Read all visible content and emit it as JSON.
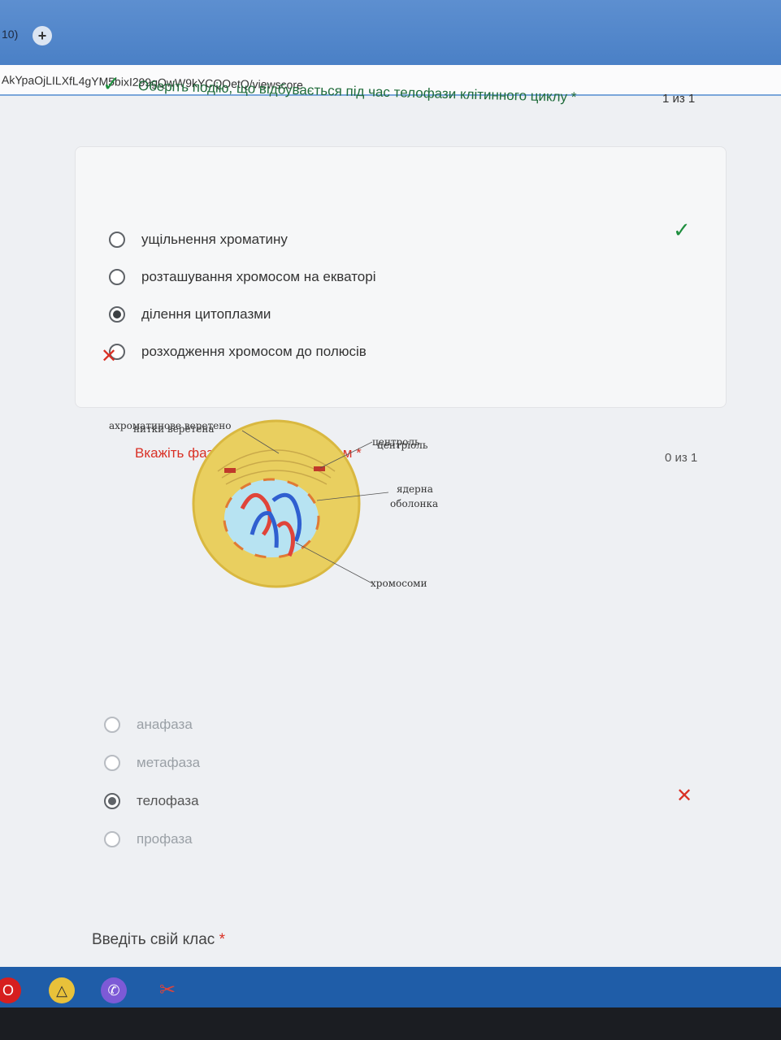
{
  "browser": {
    "tab_count": "10)",
    "new_tab_symbol": "+",
    "url": "AkYpaOjLILXfL4gYM5bixI299gQwW9kYCQOetQ/viewscore"
  },
  "question1": {
    "title": "Оберіть подію, що відбувається під час телофази клітинного циклу *",
    "score": "1 из 1",
    "status": "correct",
    "options": [
      {
        "label": "ущільнення хроматину",
        "selected": false
      },
      {
        "label": "розташування хромосом на екваторі",
        "selected": false
      },
      {
        "label": "ділення цитоплазми",
        "selected": true
      },
      {
        "label": "розходження хромосом до полюсів",
        "selected": false
      }
    ]
  },
  "question2": {
    "title": "Вкажіть фазу мітоза за малюнком *",
    "score": "0 из 1",
    "status": "incorrect",
    "diagram_labels": {
      "spindle": "ахроматинове веретено",
      "spindle_overlay": "нитки веретена",
      "centriole": "центроль",
      "centriole_overlay": "центріоль",
      "envelope_1": "ядерна",
      "envelope_2": "оболонка",
      "chromosomes": "хромосоми"
    },
    "options": [
      {
        "label": "анафаза",
        "selected": false
      },
      {
        "label": "метафаза",
        "selected": false
      },
      {
        "label": "телофаза",
        "selected": true
      },
      {
        "label": "профаза",
        "selected": false
      }
    ]
  },
  "question3": {
    "label": "Введіть свій клас",
    "required_mark": "*"
  },
  "colors": {
    "correct": "#1e8e3e",
    "incorrect": "#d93025",
    "taskbar": "#1f5da8"
  },
  "taskbar_icons": [
    "opera-icon",
    "drive-icon",
    "viber-icon",
    "app-icon"
  ]
}
